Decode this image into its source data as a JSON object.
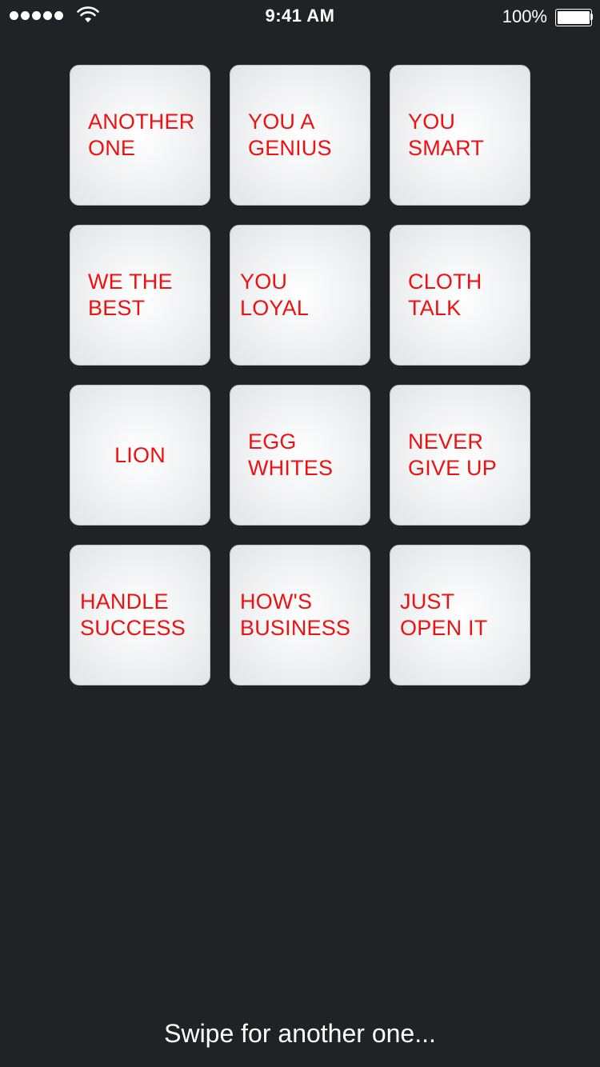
{
  "status_bar": {
    "time": "9:41 AM",
    "battery": "100%",
    "signal_bars": 5
  },
  "tiles": [
    {
      "label": "ANOTHER ONE"
    },
    {
      "label": "YOU A GENIUS"
    },
    {
      "label": "YOU SMART"
    },
    {
      "label": "WE THE BEST"
    },
    {
      "label": "YOU LOYAL"
    },
    {
      "label": "CLOTH TALK"
    },
    {
      "label": "LION"
    },
    {
      "label": "EGG WHITES"
    },
    {
      "label": "NEVER GIVE UP"
    },
    {
      "label": "HANDLE SUCCESS"
    },
    {
      "label": "HOW'S BUSINESS"
    },
    {
      "label": "JUST OPEN IT"
    }
  ],
  "footer": {
    "hint": "Swipe for another one..."
  },
  "colors": {
    "background": "#212226",
    "tile_text": "#ee1111",
    "tile_light": "#ffffff",
    "tile_dark": "#e3e4e7"
  }
}
